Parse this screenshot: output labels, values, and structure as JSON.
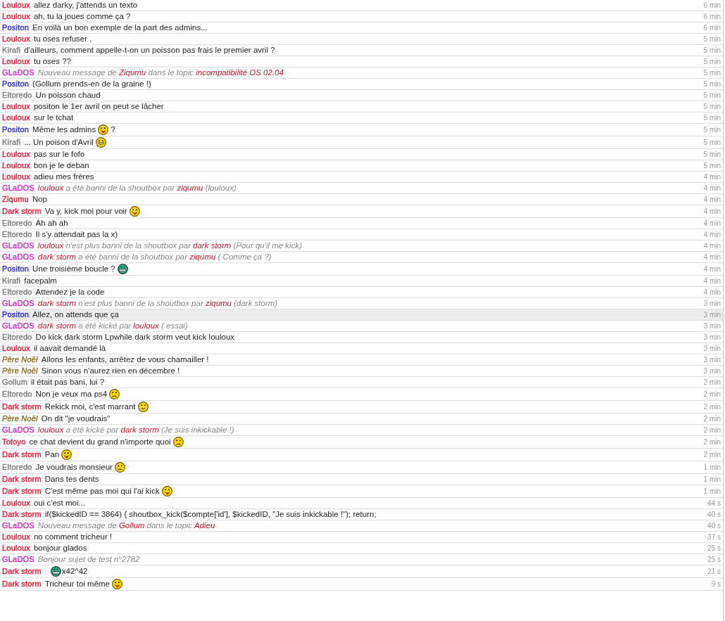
{
  "messages": [
    {
      "user": "Louloux",
      "color": "#e8102e",
      "kind": "message",
      "selected": false,
      "time": "6 min",
      "parts": [
        {
          "kind": "text",
          "text": "allez darky, j'attends un texto"
        }
      ]
    },
    {
      "user": "Louloux",
      "color": "#e8102e",
      "kind": "message",
      "selected": false,
      "time": "6 min",
      "parts": [
        {
          "kind": "text",
          "text": "ah, tu la joues comme ça ?"
        }
      ]
    },
    {
      "user": "Positon",
      "color": "#2020f0",
      "kind": "message",
      "selected": false,
      "time": "6 min",
      "parts": [
        {
          "kind": "text",
          "text": "En voilà un bon exemple de la part des admins..."
        }
      ]
    },
    {
      "user": "Louloux",
      "color": "#e8102e",
      "kind": "message",
      "selected": false,
      "time": "5 min",
      "parts": [
        {
          "kind": "text",
          "text": "tu oses refuser ,"
        }
      ]
    },
    {
      "user": "Kirafi",
      "color": "#777777",
      "kind": "message",
      "selected": false,
      "time": "5 min",
      "parts": [
        {
          "kind": "text",
          "text": "d'ailleurs, comment appelle-t-on un poisson pas frais le premier avril ?"
        }
      ]
    },
    {
      "user": "Louloux",
      "color": "#e8102e",
      "kind": "message",
      "selected": false,
      "time": "5 min",
      "parts": [
        {
          "kind": "text",
          "text": "tu oses ??"
        }
      ]
    },
    {
      "user": "GLaDOS",
      "color": "#c81ec8",
      "kind": "system",
      "selected": false,
      "time": "5 min",
      "parts": [
        {
          "kind": "text",
          "text": "Nouveau message de "
        },
        {
          "kind": "highlight",
          "text": "Ziqumu"
        },
        {
          "kind": "text",
          "text": " dans le topic "
        },
        {
          "kind": "highlight",
          "text": "incompatibilité OS 02.04"
        }
      ]
    },
    {
      "user": "Positon",
      "color": "#2020f0",
      "kind": "message",
      "selected": false,
      "time": "5 min",
      "parts": [
        {
          "kind": "text",
          "text": "(Gollum prends-en de la graine !)"
        }
      ]
    },
    {
      "user": "Eltoredo",
      "color": "#777777",
      "kind": "message",
      "selected": false,
      "time": "5 min",
      "parts": [
        {
          "kind": "text",
          "text": "Un poisson chaud"
        }
      ]
    },
    {
      "user": "Louloux",
      "color": "#e8102e",
      "kind": "message",
      "selected": false,
      "time": "5 min",
      "parts": [
        {
          "kind": "text",
          "text": "positon le 1er avril on peut se lâcher"
        }
      ]
    },
    {
      "user": "Louloux",
      "color": "#e8102e",
      "kind": "message",
      "selected": false,
      "time": "5 min",
      "parts": [
        {
          "kind": "text",
          "text": "sur le tchat"
        }
      ]
    },
    {
      "user": "Positon",
      "color": "#2020f0",
      "kind": "message",
      "selected": false,
      "time": "5 min",
      "parts": [
        {
          "kind": "text",
          "text": "Même les admins"
        },
        {
          "kind": "tongue"
        },
        {
          "kind": "text",
          "text": "?"
        }
      ]
    },
    {
      "user": "Kirafi",
      "color": "#777777",
      "kind": "message",
      "selected": false,
      "time": "5 min",
      "parts": [
        {
          "kind": "text",
          "text": "... Un poison d'Avril"
        },
        {
          "kind": "laugh"
        }
      ]
    },
    {
      "user": "Louloux",
      "color": "#e8102e",
      "kind": "message",
      "selected": false,
      "time": "5 min",
      "parts": [
        {
          "kind": "text",
          "text": "pas sur le fofo"
        }
      ]
    },
    {
      "user": "Louloux",
      "color": "#e8102e",
      "kind": "message",
      "selected": false,
      "time": "5 min",
      "parts": [
        {
          "kind": "text",
          "text": "bon je le deban"
        }
      ]
    },
    {
      "user": "Louloux",
      "color": "#e8102e",
      "kind": "message",
      "selected": false,
      "time": "4 min",
      "parts": [
        {
          "kind": "text",
          "text": "adieu mes frères"
        }
      ]
    },
    {
      "user": "GLaDOS",
      "color": "#c81ec8",
      "kind": "system",
      "selected": false,
      "time": "4 min",
      "parts": [
        {
          "kind": "highlight",
          "text": "louloux"
        },
        {
          "kind": "text",
          "text": " a été banni de la shoutbox par "
        },
        {
          "kind": "highlight",
          "text": "ziqumu"
        },
        {
          "kind": "text",
          "text": " (louloux)"
        }
      ]
    },
    {
      "user": "Ziqumu",
      "color": "#e8102e",
      "kind": "message",
      "selected": false,
      "time": "4 min",
      "parts": [
        {
          "kind": "text",
          "text": "Nop"
        }
      ]
    },
    {
      "user": "Dark storm",
      "color": "#e8102e",
      "kind": "message",
      "selected": false,
      "time": "4 min",
      "parts": [
        {
          "kind": "text",
          "text": "Va y, kick moi pour voir"
        },
        {
          "kind": "tongue"
        }
      ]
    },
    {
      "user": "Eltoredo",
      "color": "#777777",
      "kind": "message",
      "selected": false,
      "time": "4 min",
      "parts": [
        {
          "kind": "text",
          "text": "Ah ah ah"
        }
      ]
    },
    {
      "user": "Eltoredo",
      "color": "#777777",
      "kind": "message",
      "selected": false,
      "time": "4 min",
      "parts": [
        {
          "kind": "text",
          "text": "Il s'y attendait pas la x)"
        }
      ]
    },
    {
      "user": "GLaDOS",
      "color": "#c81ec8",
      "kind": "system",
      "selected": false,
      "time": "4 min",
      "parts": [
        {
          "kind": "highlight",
          "text": "louloux"
        },
        {
          "kind": "text",
          "text": " n'est plus banni de la shoutbox par "
        },
        {
          "kind": "highlight",
          "text": "dark storm"
        },
        {
          "kind": "text",
          "text": " (Pour qu'il me kick)"
        }
      ]
    },
    {
      "user": "GLaDOS",
      "color": "#c81ec8",
      "kind": "system",
      "selected": false,
      "time": "4 min",
      "parts": [
        {
          "kind": "highlight",
          "text": "dark storm"
        },
        {
          "kind": "text",
          "text": " a été banni de la shoutbox par "
        },
        {
          "kind": "highlight",
          "text": "ziqumu"
        },
        {
          "kind": "text",
          "text": " ( Comme ça ?)"
        }
      ]
    },
    {
      "user": "Positon",
      "color": "#2020f0",
      "kind": "message",
      "selected": false,
      "time": "4 min",
      "parts": [
        {
          "kind": "text",
          "text": "Une troisième boucle ?"
        },
        {
          "kind": "grin"
        }
      ]
    },
    {
      "user": "Kirafi",
      "color": "#777777",
      "kind": "message",
      "selected": false,
      "time": "4 min",
      "parts": [
        {
          "kind": "text",
          "text": "facepalm"
        }
      ]
    },
    {
      "user": "Eltoredo",
      "color": "#777777",
      "kind": "message",
      "selected": false,
      "time": "4 min",
      "parts": [
        {
          "kind": "text",
          "text": "Attendez je la code"
        }
      ]
    },
    {
      "user": "GLaDOS",
      "color": "#c81ec8",
      "kind": "system",
      "selected": false,
      "time": "3 min",
      "parts": [
        {
          "kind": "highlight",
          "text": "dark storm"
        },
        {
          "kind": "text",
          "text": " n'est plus banni de la shoutbox par "
        },
        {
          "kind": "highlight",
          "text": "ziqumu"
        },
        {
          "kind": "text",
          "text": " (dark storm)"
        }
      ]
    },
    {
      "user": "Positon",
      "color": "#2020f0",
      "kind": "message",
      "selected": true,
      "time": "3 min",
      "parts": [
        {
          "kind": "text",
          "text": "Allez, on attends que ça"
        }
      ]
    },
    {
      "user": "GLaDOS",
      "color": "#c81ec8",
      "kind": "system",
      "selected": false,
      "time": "3 min",
      "parts": [
        {
          "kind": "highlight",
          "text": "dark storm"
        },
        {
          "kind": "text",
          "text": " a été kické par "
        },
        {
          "kind": "highlight",
          "text": "louloux"
        },
        {
          "kind": "text",
          "text": " ( essai)"
        }
      ]
    },
    {
      "user": "Eltoredo",
      "color": "#777777",
      "kind": "message",
      "selected": false,
      "time": "3 min",
      "parts": [
        {
          "kind": "text",
          "text": "Do kick dark storm Lpwhile dark storm veut kick louloux"
        }
      ]
    },
    {
      "user": "Louloux",
      "color": "#e8102e",
      "kind": "message",
      "selected": false,
      "time": "3 min",
      "parts": [
        {
          "kind": "text",
          "text": "il aavait demandé là"
        }
      ]
    },
    {
      "user": "Père Noël",
      "color": "#8a6a1c",
      "kind": "guest",
      "selected": false,
      "time": "3 min",
      "parts": [
        {
          "kind": "text",
          "text": "Allons les enfants, arrêtez de vous chamailler !"
        }
      ]
    },
    {
      "user": "Père Noël",
      "color": "#8a6a1c",
      "kind": "guest",
      "selected": false,
      "time": "3 min",
      "parts": [
        {
          "kind": "text",
          "text": "Sinon vous n'aurez rien en décembre !"
        }
      ]
    },
    {
      "user": "Gollum",
      "color": "#777777",
      "kind": "message",
      "selected": false,
      "time": "2 min",
      "parts": [
        {
          "kind": "text",
          "text": "il était pas bani, lui ?"
        }
      ]
    },
    {
      "user": "Eltoredo",
      "color": "#777777",
      "kind": "message",
      "selected": false,
      "time": "2 min",
      "parts": [
        {
          "kind": "text",
          "text": "Non je veux ma ps4"
        },
        {
          "kind": "sad"
        }
      ]
    },
    {
      "user": "Dark storm",
      "color": "#e8102e",
      "kind": "message",
      "selected": false,
      "time": "2 min",
      "parts": [
        {
          "kind": "text",
          "text": "Rekick moi, c'est marrant"
        },
        {
          "kind": "smile"
        }
      ]
    },
    {
      "user": "Père Noël",
      "color": "#8a6a1c",
      "kind": "guest",
      "selected": false,
      "time": "2 min",
      "parts": [
        {
          "kind": "text",
          "text": "On dit \"je voudrais\""
        }
      ]
    },
    {
      "user": "GLaDOS",
      "color": "#c81ec8",
      "kind": "system",
      "selected": false,
      "time": "2 min",
      "parts": [
        {
          "kind": "highlight",
          "text": "louloux"
        },
        {
          "kind": "text",
          "text": " a été kické par "
        },
        {
          "kind": "highlight",
          "text": "dark storm"
        },
        {
          "kind": "text",
          "text": " (Je suis inkickable !)"
        }
      ]
    },
    {
      "user": "Totoyo",
      "color": "#e8102e",
      "kind": "message",
      "selected": false,
      "time": "2 min",
      "parts": [
        {
          "kind": "text",
          "text": "ce chat devient du grand n'importe quoi"
        },
        {
          "kind": "sad"
        }
      ]
    },
    {
      "user": "Dark storm",
      "color": "#e8102e",
      "kind": "message",
      "selected": false,
      "time": "2 min",
      "parts": [
        {
          "kind": "text",
          "text": "Pan"
        },
        {
          "kind": "tongue"
        }
      ]
    },
    {
      "user": "Eltoredo",
      "color": "#777777",
      "kind": "message",
      "selected": false,
      "time": "1 min",
      "parts": [
        {
          "kind": "text",
          "text": "Je voudrais monsieur"
        },
        {
          "kind": "sad"
        }
      ]
    },
    {
      "user": "Dark storm",
      "color": "#e8102e",
      "kind": "message",
      "selected": false,
      "time": "1 min",
      "parts": [
        {
          "kind": "text",
          "text": "Dans tes dents"
        }
      ]
    },
    {
      "user": "Dark storm",
      "color": "#e8102e",
      "kind": "message",
      "selected": false,
      "time": "1 min",
      "parts": [
        {
          "kind": "text",
          "text": "C'est même pas moi qui l'ai kick"
        },
        {
          "kind": "tongue"
        }
      ]
    },
    {
      "user": "Louloux",
      "color": "#e8102e",
      "kind": "message",
      "selected": false,
      "time": "44 s",
      "parts": [
        {
          "kind": "text",
          "text": "oui c'est moi..."
        }
      ]
    },
    {
      "user": "Dark storm",
      "color": "#e8102e",
      "kind": "message",
      "selected": false,
      "time": "40 s",
      "parts": [
        {
          "kind": "text",
          "text": "if($kickedID == 3864) { shoutbox_kick($compte['id'], $kickedID, \"Je suis inkickable !\"); return;"
        }
      ]
    },
    {
      "user": "GLaDOS",
      "color": "#c81ec8",
      "kind": "system",
      "selected": false,
      "time": "40 s",
      "parts": [
        {
          "kind": "text",
          "text": "Nouveau message de "
        },
        {
          "kind": "highlight",
          "text": "Gollum"
        },
        {
          "kind": "text",
          "text": " dans le topic "
        },
        {
          "kind": "highlight",
          "text": "Adieu"
        }
      ]
    },
    {
      "user": "Louloux",
      "color": "#e8102e",
      "kind": "message",
      "selected": false,
      "time": "37 s",
      "parts": [
        {
          "kind": "text",
          "text": "no comment tricheur !"
        }
      ]
    },
    {
      "user": "Louloux",
      "color": "#e8102e",
      "kind": "message",
      "selected": false,
      "time": "25 s",
      "parts": [
        {
          "kind": "text",
          "text": "bonjour glados"
        }
      ]
    },
    {
      "user": "GLaDOS",
      "color": "#c81ec8",
      "kind": "system",
      "selected": false,
      "time": "25 s",
      "parts": [
        {
          "kind": "text",
          "text": "Bonjour sujet de test n°2782"
        }
      ]
    },
    {
      "user": "Dark storm",
      "color": "#e8102e",
      "kind": "message",
      "selected": false,
      "time": "21 s",
      "parts": [
        {
          "kind": "grin"
        },
        {
          "kind": "text",
          "text": "x42^42"
        }
      ]
    },
    {
      "user": "Dark storm",
      "color": "#e8102e",
      "kind": "message",
      "selected": false,
      "time": "9 s",
      "parts": [
        {
          "kind": "text",
          "text": "Tricheur toi même"
        },
        {
          "kind": "tongue"
        }
      ]
    }
  ]
}
